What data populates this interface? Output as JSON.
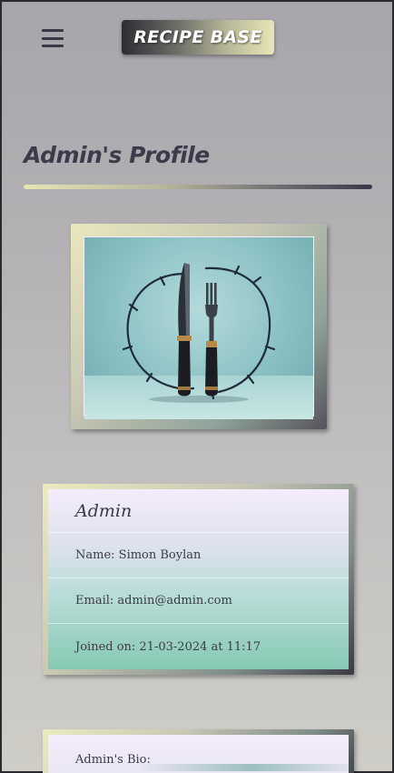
{
  "header": {
    "menu_icon": "hamburger-menu-icon",
    "brand": "RECIPE BASE"
  },
  "page": {
    "title": "Admin's Profile"
  },
  "profile_image": {
    "icon": "knife-and-fork-icon"
  },
  "details": {
    "username": "Admin",
    "name": "Name: Simon Boylan",
    "email": "Email: admin@admin.com",
    "joined": "Joined on: 21-03-2024 at 11:17"
  },
  "bio": {
    "label": "Admin's Bio:"
  },
  "colors": {
    "title": "#3e3a4c",
    "accent_light": "#e6e6b4",
    "accent_dark": "#3a3847",
    "card_mint": "#86c9b3"
  }
}
